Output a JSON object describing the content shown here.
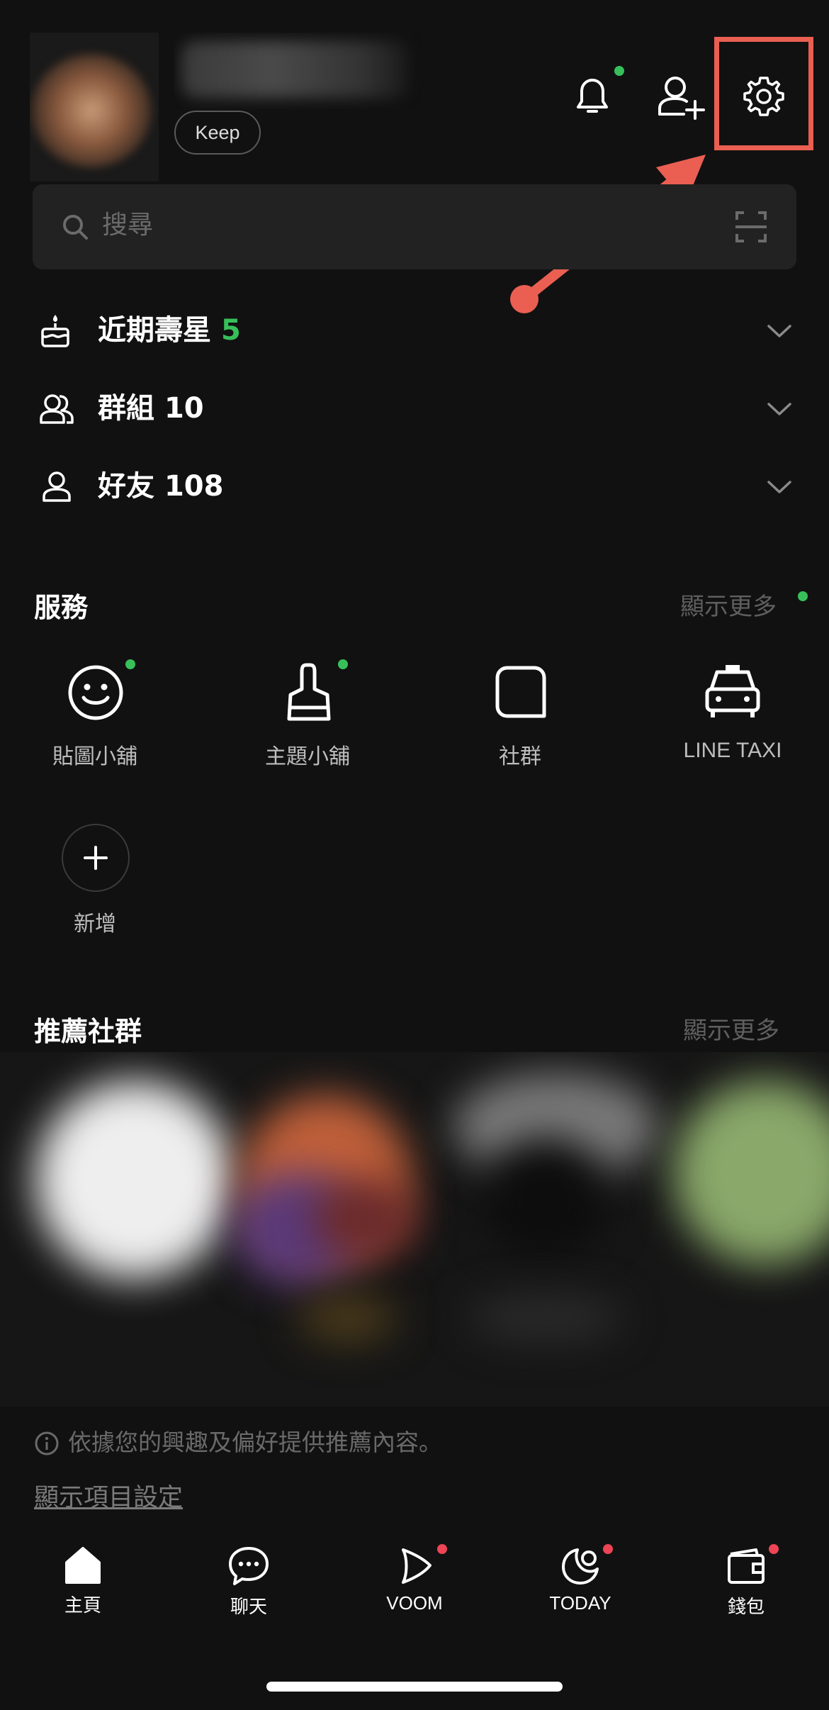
{
  "header": {
    "keep_label": "Keep"
  },
  "search": {
    "placeholder": "搜尋"
  },
  "lists": {
    "birthdays": {
      "label": "近期壽星",
      "count": "5"
    },
    "groups": {
      "label": "群組",
      "count": "10"
    },
    "friends": {
      "label": "好友",
      "count": "108"
    }
  },
  "services": {
    "title": "服務",
    "more": "顯示更多",
    "items": [
      {
        "label": "貼圖小舖",
        "icon": "smiley-icon",
        "new": true
      },
      {
        "label": "主題小舖",
        "icon": "brush-icon",
        "new": true
      },
      {
        "label": "社群",
        "icon": "openchat-icon",
        "new": false
      },
      {
        "label": "LINE TAXI",
        "icon": "taxi-icon",
        "new": false
      }
    ],
    "add_label": "新增"
  },
  "recommended": {
    "title": "推薦社群",
    "more": "顯示更多",
    "info": "依據您的興趣及偏好提供推薦內容。",
    "settings_link": "顯示項目設定"
  },
  "tabs": [
    {
      "label": "主頁",
      "icon": "home-icon",
      "badge": false
    },
    {
      "label": "聊天",
      "icon": "chat-icon",
      "badge": false
    },
    {
      "label": "VOOM",
      "icon": "voom-icon",
      "badge": true
    },
    {
      "label": "TODAY",
      "icon": "today-icon",
      "badge": true
    },
    {
      "label": "錢包",
      "icon": "wallet-icon",
      "badge": true
    }
  ],
  "colors": {
    "background": "#111111",
    "accent_green": "#37c05a",
    "badge_red": "#ee4455",
    "annotation": "#ea5f52"
  }
}
